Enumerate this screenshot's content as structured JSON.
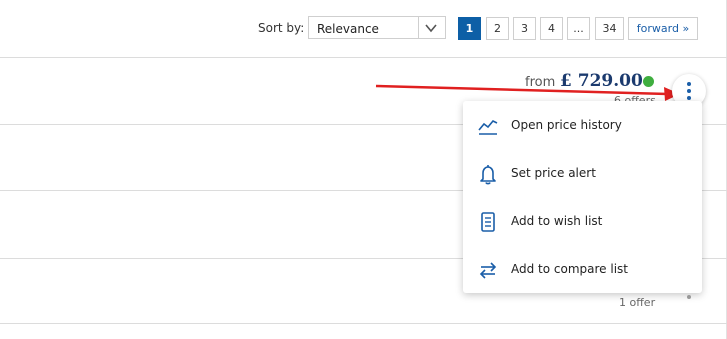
{
  "toolbar": {
    "sort_label": "Sort by:",
    "sort_value": "Relevance",
    "pages": [
      "1",
      "2",
      "3",
      "4",
      "...",
      "34"
    ],
    "forward_label": "forward »",
    "active_page": "1"
  },
  "product": {
    "from_label": "from",
    "price": "£ 729.00",
    "offers_top": "6 offers",
    "offers_bottom": "1 offer"
  },
  "menu": {
    "items": [
      {
        "label": "Open price history",
        "icon": "price-history-icon"
      },
      {
        "label": "Set price alert",
        "icon": "bell-icon"
      },
      {
        "label": "Add to wish list",
        "icon": "wish-list-icon"
      },
      {
        "label": "Add to compare list",
        "icon": "compare-icon"
      }
    ]
  },
  "colors": {
    "accent": "#0d5fa6",
    "price": "#1b3a6e",
    "availability": "#3fae3f",
    "annotation_arrow": "#e02020"
  }
}
